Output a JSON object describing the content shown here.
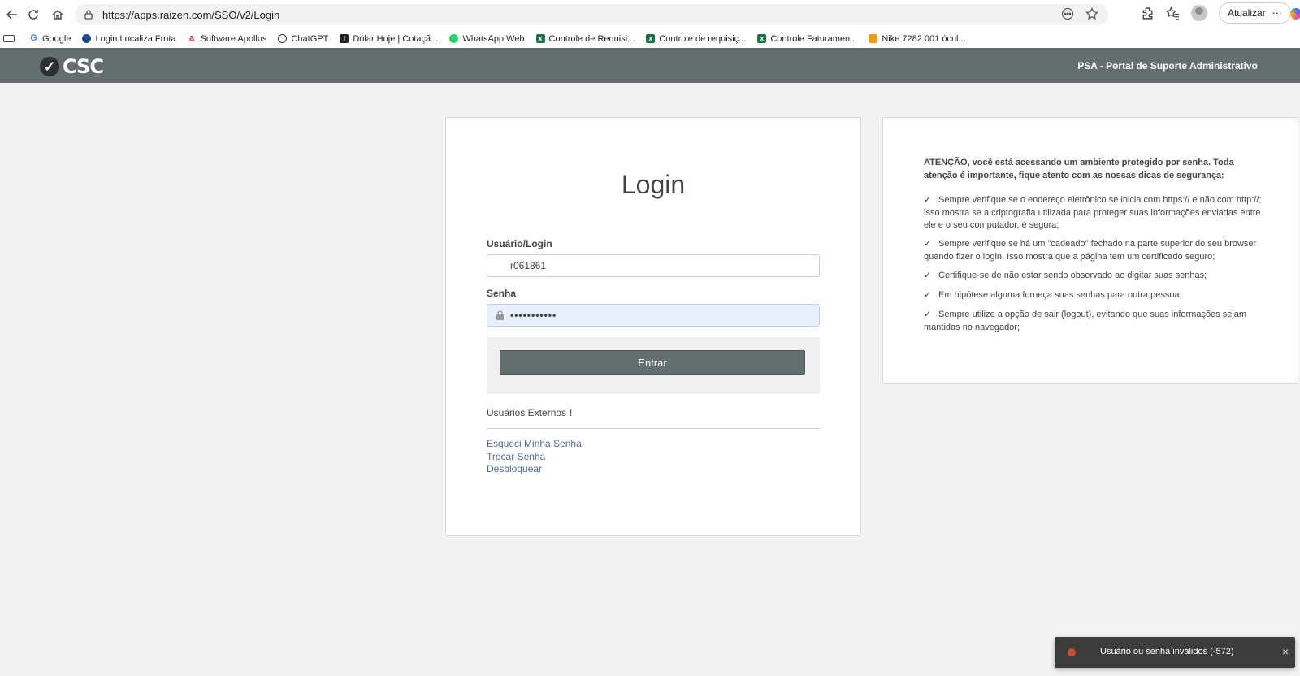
{
  "browser": {
    "url": "https://apps.raizen.com/SSO/v2/Login",
    "update_label": "Atualizar",
    "bookmarks": [
      {
        "label": "Google",
        "icon": "google-icon",
        "color": "#4285f4"
      },
      {
        "label": "Login Localiza Frota",
        "icon": "localiza-icon",
        "color": "#1a4a8a"
      },
      {
        "label": "Software Apollus",
        "icon": "apollus-icon",
        "color": "#d0342c"
      },
      {
        "label": "ChatGPT",
        "icon": "chatgpt-icon",
        "color": "#333333"
      },
      {
        "label": "Dólar Hoje | Cotaçã...",
        "icon": "inv-icon",
        "color": "#222222"
      },
      {
        "label": "WhatsApp Web",
        "icon": "whatsapp-icon",
        "color": "#25d366"
      },
      {
        "label": "Controle de Requisi...",
        "icon": "excel-icon",
        "color": "#1e7145"
      },
      {
        "label": "Controle de requisiç...",
        "icon": "excel-icon",
        "color": "#1e7145"
      },
      {
        "label": "Controle Faturamen...",
        "icon": "excel-icon",
        "color": "#1e7145"
      },
      {
        "label": "Nike 7282 001 ócul...",
        "icon": "shop-icon",
        "color": "#f39c12"
      }
    ]
  },
  "header": {
    "logo_text": "CSC",
    "portal_title": "PSA - Portal de Suporte Administrativo",
    "bg_color": "#636e6e"
  },
  "login": {
    "title": "Login",
    "user_label": "Usuário/Login",
    "user_value": "r061861",
    "password_label": "Senha",
    "password_value": "•••••••••••",
    "submit_label": "Entrar",
    "external_users": "Usuários Externos",
    "external_mark": "!",
    "links": [
      "Esqueci Minha Senha",
      "Trocar Senha",
      "Desbloquear"
    ]
  },
  "info": {
    "intro": "ATENÇÃO, você está acessando um ambiente protegido por senha. Toda atenção é importante, fique atento com as nossas dicas de segurança:",
    "check_mark": "✓",
    "items": [
      "Sempre verifique se o endereço eletrônico se inicia com https:// e não com http://; isso mostra se a criptografia utilizada para proteger suas informações enviadas entre ele e o seu computador, é segura;",
      "Sempre verifique se há um \"cadeado\" fechado na parte superior do seu browser quando fizer o login. Isso mostra que a página tem um certificado seguro;",
      "Certifique-se de não estar sendo observado ao digitar suas senhas;",
      "Em hipótese alguma forneça suas senhas para outra pessoa;",
      "Sempre utilize a opção de sair (logout), evitando que suas informações sejam mantidas no navegador;"
    ]
  },
  "toast": {
    "message": "Usuário ou senha inválidos (-572)",
    "close": "×",
    "status_color": "#d04a2a"
  }
}
